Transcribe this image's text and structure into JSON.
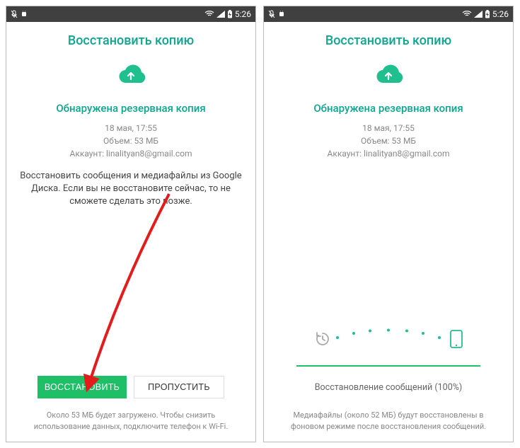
{
  "status": {
    "time": "5:26"
  },
  "screen1": {
    "title": "Восстановить копию",
    "subtitle": "Обнаружена резервная копия",
    "date": "18 мая, 17:55",
    "size": "Объем: 53 МБ",
    "account": "Аккаунт: linalityan8@gmail.com",
    "desc": "Восстановить сообщения и медиафайлы из Google Диска. Если вы не восстановите сейчас, то не сможете сделать это позже.",
    "restore_btn": "ВОССТАНОВИТЬ",
    "skip_btn": "ПРОПУСТИТЬ",
    "footer": "Около 53 МБ будет загружено. Чтобы снизить использование данных, подключите телефон к Wi-Fi."
  },
  "screen2": {
    "title": "Восстановить копию",
    "subtitle": "Обнаружена резервная копия",
    "date": "18 мая, 17:55",
    "size": "Объем: 53 МБ",
    "account": "Аккаунт: linalityan8@gmail.com",
    "progress_text": "Восстановление сообщений (100%)",
    "footer": "Медиафайлы (около 52 МБ) будут восстановлены в фоновом режиме после восстановления сообщений."
  }
}
